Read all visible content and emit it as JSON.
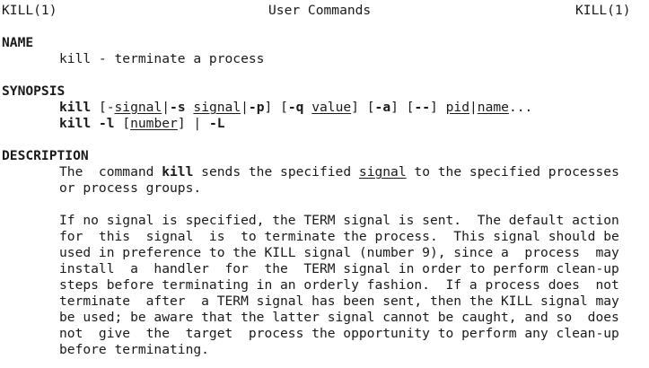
{
  "header": {
    "left": "KILL(1)",
    "center": "User Commands",
    "right": "KILL(1)"
  },
  "name_section": {
    "heading": "NAME",
    "text": "kill - terminate a process"
  },
  "synopsis": {
    "heading": "SYNOPSIS",
    "line1": {
      "cmd": "kill",
      "p1": " [-",
      "signal1": "signal",
      "p2": "|",
      "s_flag": "-s",
      "p3": " ",
      "signal2": "signal",
      "p4": "|",
      "p_flag": "-p",
      "p5": "] [",
      "q_flag": "-q",
      "p6": " ",
      "value": "value",
      "p7": "] [",
      "a_flag": "-a",
      "p8": "] [",
      "dd_flag": "--",
      "p9": "] ",
      "pid": "pid",
      "p10": "|",
      "name": "name",
      "p11": "..."
    },
    "line2": {
      "cmd": "kill",
      "p1": " ",
      "l_flag": "-l",
      "p2": " [",
      "number": "number",
      "p3": "] | ",
      "L_flag": "-L"
    }
  },
  "description": {
    "heading": "DESCRIPTION",
    "para1_line1": {
      "a": "The  command ",
      "kill": "kill",
      "b": " sends the specified ",
      "signal": "signal",
      "c": " to the specified processes"
    },
    "para1_line2": "or process groups.",
    "para2": [
      "If no signal is specified, the TERM signal is sent.  The default action",
      "for  this  signal  is  to terminate the process.  This signal should be",
      "used in preference to the KILL signal (number 9), since a  process  may",
      "install  a  handler  for  the  TERM signal in order to perform clean-up",
      "steps before terminating in an orderly fashion.  If a process does  not",
      "terminate  after  a TERM signal has been sent, then the KILL signal may",
      "be used; be aware that the latter signal cannot be caught, and so  does",
      "not  give  the  target  process the opportunity to perform any clean-up",
      "before terminating."
    ]
  }
}
